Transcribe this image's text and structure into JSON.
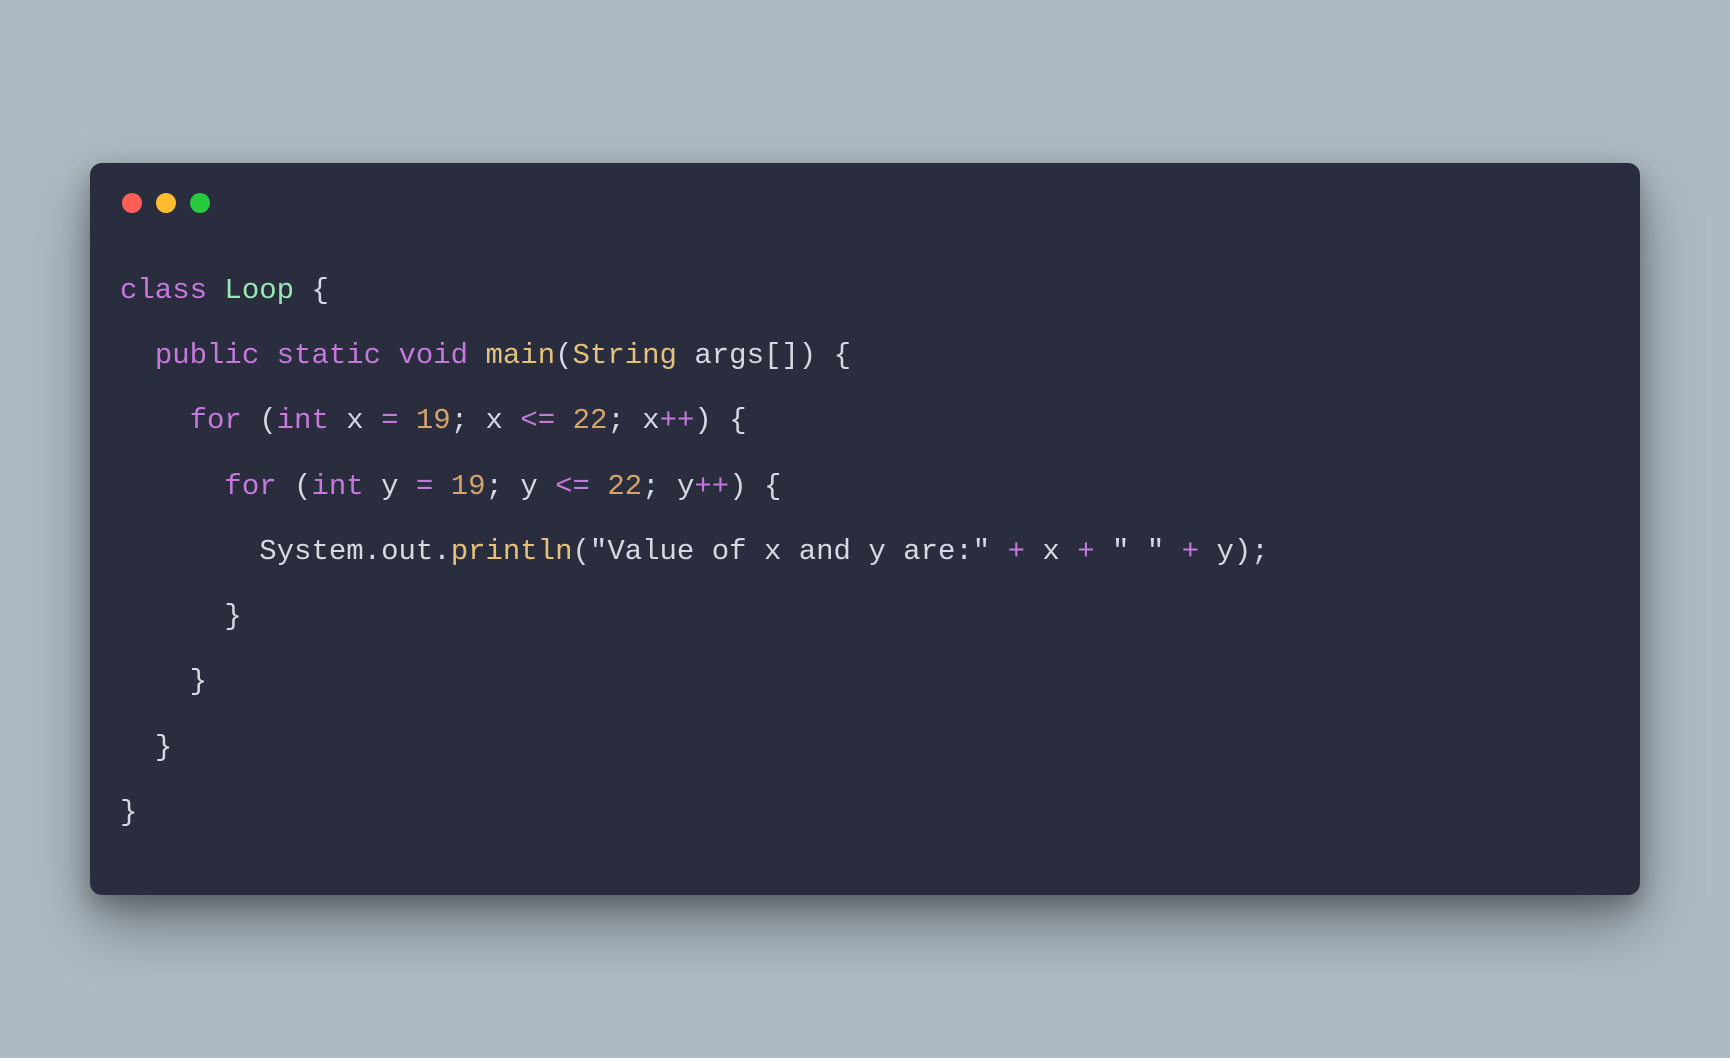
{
  "colors": {
    "background": "#aeb9c2",
    "editor_bg": "#292d3e",
    "traffic_red": "#ff5f56",
    "traffic_yellow": "#ffbd2e",
    "traffic_green": "#27c93f",
    "keyword": "#c678dd",
    "classname": "#98e6b2",
    "type": "#e6c17a",
    "function": "#e6c17a",
    "number": "#d6a36a",
    "operator": "#c678dd",
    "default": "#d6d9e4"
  },
  "code": {
    "language": "java",
    "plain_text": "class Loop {\n  public static void main(String args[]) {\n    for (int x = 19; x <= 22; x++) {\n      for (int y = 19; y <= 22; y++) {\n        System.out.println(\"Value of x and y are:\" + x + \" \" + y);\n      }\n    }\n  }\n}",
    "lines": [
      [
        {
          "t": "class",
          "c": "kw"
        },
        {
          "t": " "
        },
        {
          "t": "Loop",
          "c": "class"
        },
        {
          "t": " "
        },
        {
          "t": "{",
          "c": "punc"
        }
      ],
      [
        {
          "t": "  "
        },
        {
          "t": "public",
          "c": "kw"
        },
        {
          "t": " "
        },
        {
          "t": "static",
          "c": "kw"
        },
        {
          "t": " "
        },
        {
          "t": "void",
          "c": "kw"
        },
        {
          "t": " "
        },
        {
          "t": "main",
          "c": "fn"
        },
        {
          "t": "(",
          "c": "punc"
        },
        {
          "t": "String",
          "c": "type"
        },
        {
          "t": " "
        },
        {
          "t": "args",
          "c": "ident"
        },
        {
          "t": "[]",
          "c": "punc"
        },
        {
          "t": ")",
          "c": "punc"
        },
        {
          "t": " "
        },
        {
          "t": "{",
          "c": "punc"
        }
      ],
      [
        {
          "t": "    "
        },
        {
          "t": "for",
          "c": "kw"
        },
        {
          "t": " "
        },
        {
          "t": "(",
          "c": "punc"
        },
        {
          "t": "int",
          "c": "kw"
        },
        {
          "t": " "
        },
        {
          "t": "x",
          "c": "ident"
        },
        {
          "t": " "
        },
        {
          "t": "=",
          "c": "op"
        },
        {
          "t": " "
        },
        {
          "t": "19",
          "c": "num"
        },
        {
          "t": ";",
          "c": "punc"
        },
        {
          "t": " "
        },
        {
          "t": "x",
          "c": "ident"
        },
        {
          "t": " "
        },
        {
          "t": "<=",
          "c": "op"
        },
        {
          "t": " "
        },
        {
          "t": "22",
          "c": "num"
        },
        {
          "t": ";",
          "c": "punc"
        },
        {
          "t": " "
        },
        {
          "t": "x",
          "c": "ident"
        },
        {
          "t": "++",
          "c": "op"
        },
        {
          "t": ")",
          "c": "punc"
        },
        {
          "t": " "
        },
        {
          "t": "{",
          "c": "punc"
        }
      ],
      [
        {
          "t": "      "
        },
        {
          "t": "for",
          "c": "kw"
        },
        {
          "t": " "
        },
        {
          "t": "(",
          "c": "punc"
        },
        {
          "t": "int",
          "c": "kw"
        },
        {
          "t": " "
        },
        {
          "t": "y",
          "c": "ident"
        },
        {
          "t": " "
        },
        {
          "t": "=",
          "c": "op"
        },
        {
          "t": " "
        },
        {
          "t": "19",
          "c": "num"
        },
        {
          "t": ";",
          "c": "punc"
        },
        {
          "t": " "
        },
        {
          "t": "y",
          "c": "ident"
        },
        {
          "t": " "
        },
        {
          "t": "<=",
          "c": "op"
        },
        {
          "t": " "
        },
        {
          "t": "22",
          "c": "num"
        },
        {
          "t": ";",
          "c": "punc"
        },
        {
          "t": " "
        },
        {
          "t": "y",
          "c": "ident"
        },
        {
          "t": "++",
          "c": "op"
        },
        {
          "t": ")",
          "c": "punc"
        },
        {
          "t": " "
        },
        {
          "t": "{",
          "c": "punc"
        }
      ],
      [
        {
          "t": "        "
        },
        {
          "t": "System",
          "c": "ident"
        },
        {
          "t": ".",
          "c": "punc"
        },
        {
          "t": "out",
          "c": "ident"
        },
        {
          "t": ".",
          "c": "punc"
        },
        {
          "t": "println",
          "c": "fn"
        },
        {
          "t": "(",
          "c": "punc"
        },
        {
          "t": "\"Value of x and y are:\"",
          "c": "str"
        },
        {
          "t": " "
        },
        {
          "t": "+",
          "c": "op"
        },
        {
          "t": " "
        },
        {
          "t": "x",
          "c": "ident"
        },
        {
          "t": " "
        },
        {
          "t": "+",
          "c": "op"
        },
        {
          "t": " "
        },
        {
          "t": "\" \"",
          "c": "str"
        },
        {
          "t": " "
        },
        {
          "t": "+",
          "c": "op"
        },
        {
          "t": " "
        },
        {
          "t": "y",
          "c": "ident"
        },
        {
          "t": ")",
          "c": "punc"
        },
        {
          "t": ";",
          "c": "punc"
        }
      ],
      [
        {
          "t": "      "
        },
        {
          "t": "}",
          "c": "punc"
        }
      ],
      [
        {
          "t": "    "
        },
        {
          "t": "}",
          "c": "punc"
        }
      ],
      [
        {
          "t": "  "
        },
        {
          "t": "}",
          "c": "punc"
        }
      ],
      [
        {
          "t": "}",
          "c": "punc"
        }
      ]
    ]
  }
}
